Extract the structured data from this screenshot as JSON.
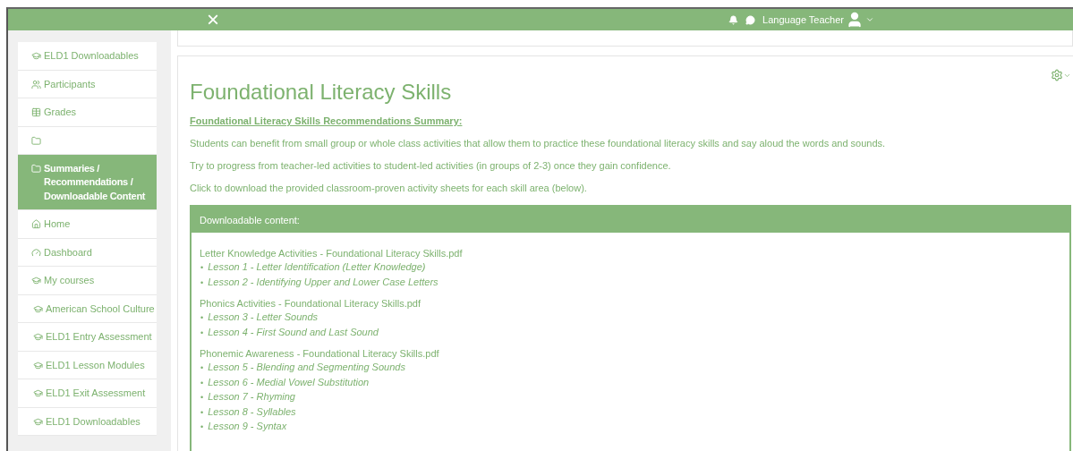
{
  "header": {
    "close": "×",
    "user_name": "Language Teacher"
  },
  "sidebar": {
    "items": [
      {
        "label": "ELD1 Downloadables",
        "kind": "cap",
        "selected": false
      },
      {
        "label": "Participants",
        "kind": "users",
        "selected": false
      },
      {
        "label": "Grades",
        "kind": "table",
        "selected": false
      },
      {
        "kind": "folder",
        "selected": false
      },
      {
        "label": "Summaries / Recommendations / Downloadable Content",
        "kind": "folder",
        "selected": true
      },
      {
        "label": "Home",
        "kind": "home",
        "selected": false
      },
      {
        "label": "Dashboard",
        "kind": "dashboard",
        "selected": false
      },
      {
        "label": "My courses",
        "kind": "cap",
        "selected": false
      },
      {
        "label": "American School Culture",
        "kind": "course",
        "selected": false
      },
      {
        "label": "ELD1 Entry Assessment",
        "kind": "course",
        "selected": false
      },
      {
        "label": "ELD1 Lesson Modules",
        "kind": "course",
        "selected": false
      },
      {
        "label": "ELD1 Exit Assessment",
        "kind": "course",
        "selected": false
      },
      {
        "label": "ELD1 Downloadables",
        "kind": "course",
        "selected": false
      }
    ]
  },
  "page": {
    "title": "Foundational Literacy Skills",
    "summary_heading": "Foundational Literacy Skills Recommendations Summary:",
    "paragraphs": [
      "Students can benefit from small group or whole class activities that allow them to practice these foundational literacy skills and say aloud the words and sounds.",
      "Try to progress from teacher-led activities to student-led activities (in groups of 2-3) once they gain confidence.",
      "Click to download the provided classroom-proven activity sheets for each skill area (below)."
    ],
    "download_box": {
      "heading": "Downloadable content:",
      "bullet": "•",
      "groups": [
        {
          "file": "Letter Knowledge Activities - Foundational Literacy Skills.pdf",
          "lessons": [
            "Lesson 1 - Letter Identification (Letter Knowledge)",
            "Lesson 2 - Identifying Upper and Lower Case Letters"
          ]
        },
        {
          "file": "Phonics Activities - Foundational Literacy Skills.pdf",
          "lessons": [
            "Lesson 3 - Letter Sounds",
            "Lesson 4 - First Sound and Last Sound"
          ]
        },
        {
          "file": "Phonemic Awareness - Foundational Literacy Skills.pdf",
          "lessons": [
            "Lesson 5 - Blending and Segmenting Sounds",
            "Lesson 6 - Medial Vowel Substitution",
            "Lesson 7 - Rhyming",
            "Lesson 8 - Syllables",
            "Lesson 9 - Syntax"
          ]
        }
      ]
    }
  }
}
